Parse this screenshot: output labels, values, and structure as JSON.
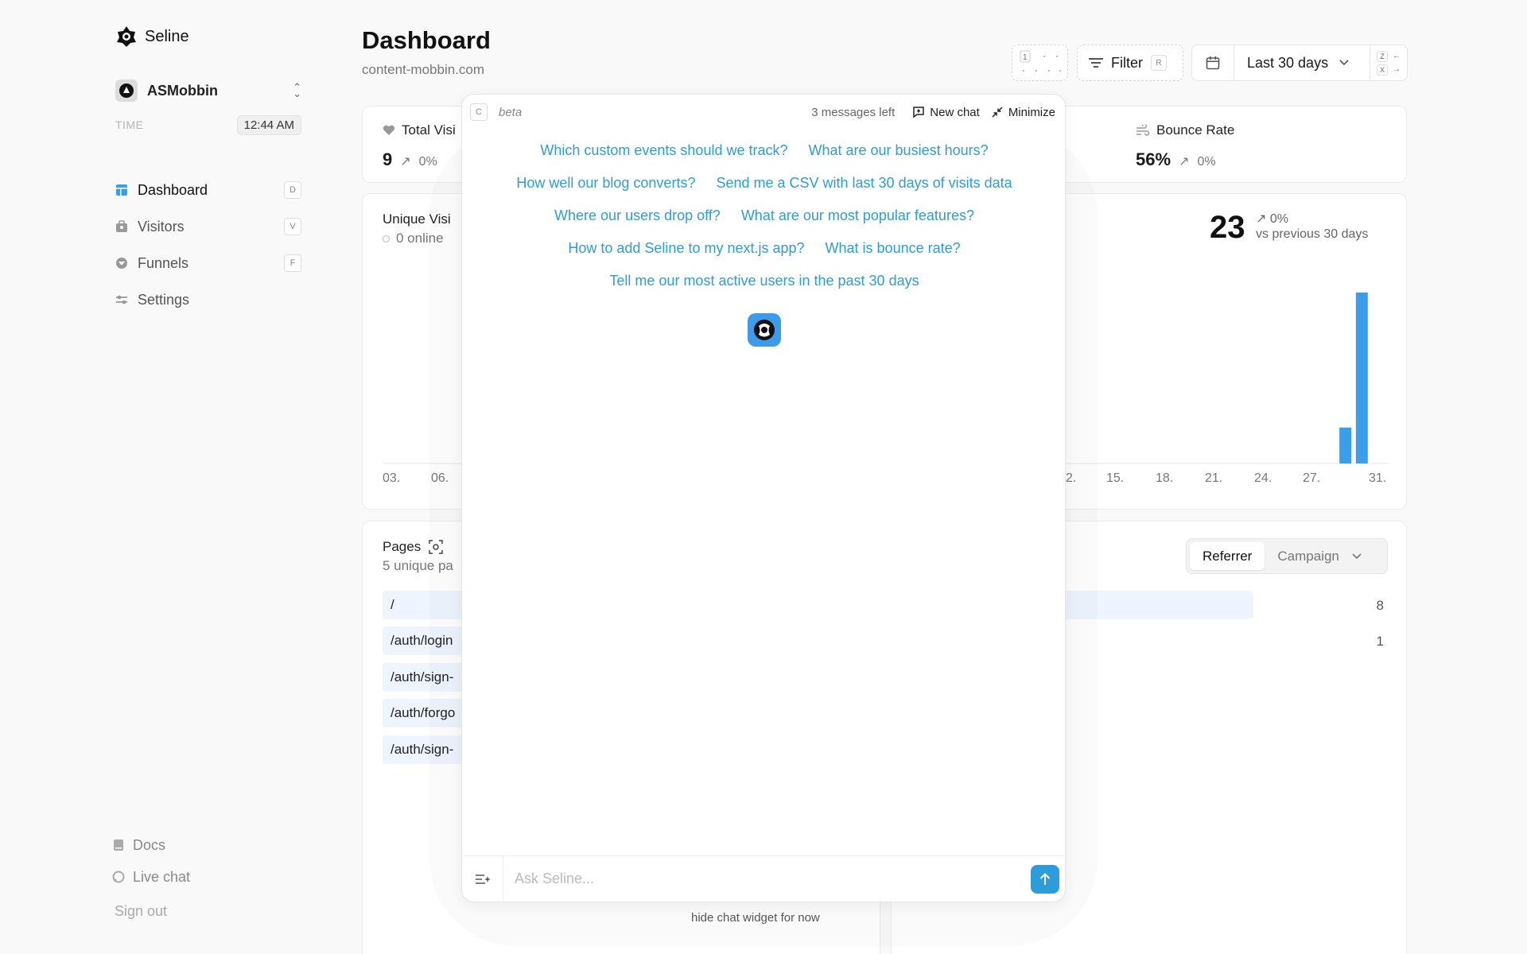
{
  "sidebar": {
    "logo_text": "Seline",
    "org_name": "ASMobbin",
    "time_label": "TIME",
    "time_value": "12:44 AM",
    "nav": [
      {
        "label": "Dashboard",
        "key": "D"
      },
      {
        "label": "Visitors",
        "key": "V"
      },
      {
        "label": "Funnels",
        "key": "F"
      },
      {
        "label": "Settings",
        "key": ""
      }
    ],
    "docs_label": "Docs",
    "livechat_label": "Live chat",
    "signout_label": "Sign out"
  },
  "header": {
    "title": "Dashboard",
    "subtitle": "content-mobbin.com",
    "dots_key": "1",
    "filter_label": "Filter",
    "filter_key": "R",
    "range_label": "Last 30 days",
    "zoom_in_key": "Z",
    "zoom_out_key": "X"
  },
  "stats": {
    "total_visits_label": "Total Visi",
    "total_visits_value": "9",
    "total_visits_change": "0%",
    "bounce_label": "Bounce Rate",
    "bounce_value": "56%",
    "bounce_change": "0%"
  },
  "chart_card": {
    "title": "Unique Visi",
    "online": "0 online",
    "big_number": "23",
    "change": "0%",
    "compare": "vs previous 30 days"
  },
  "chart_data": {
    "type": "bar",
    "x_ticks_left": [
      "03.",
      "06."
    ],
    "x_ticks_right": [
      "2.",
      "15.",
      "18.",
      "21.",
      "24.",
      "27.",
      "31."
    ],
    "bars": [
      {
        "x": 29,
        "value": 4
      },
      {
        "x": 30,
        "value": 19
      }
    ],
    "ylim": [
      0,
      19
    ],
    "grid": false,
    "color": "#3b9eea"
  },
  "pages": {
    "title": "Pages",
    "subtitle": "5 unique pa",
    "rows": [
      "/",
      "/auth/login",
      "/auth/sign-",
      "/auth/forgo",
      "/auth/sign-"
    ]
  },
  "referrers": {
    "tab_referrer": "Referrer",
    "tab_campaign": "Campaign",
    "counts": [
      "8",
      "1"
    ]
  },
  "chat": {
    "key": "C",
    "beta_label": "beta",
    "messages_left": "3 messages left",
    "new_chat_label": "New chat",
    "minimize_label": "Minimize",
    "suggestions": [
      [
        "Which custom events should we track?",
        "What are our busiest hours?"
      ],
      [
        "How well our blog converts?",
        "Send me a CSV with last 30 days of visits data"
      ],
      [
        "Where our users drop off?",
        "What are our most popular features?"
      ],
      [
        "How to add Seline to my next.js app?",
        "What is bounce rate?"
      ],
      [
        "Tell me our most active users in the past 30 days"
      ]
    ],
    "input_placeholder": "Ask Seline...",
    "hide_label": "hide chat widget for now"
  },
  "colors": {
    "accent": "#2d9cdb",
    "bar": "#3b9eea",
    "row_bg": "#eef5fe"
  }
}
